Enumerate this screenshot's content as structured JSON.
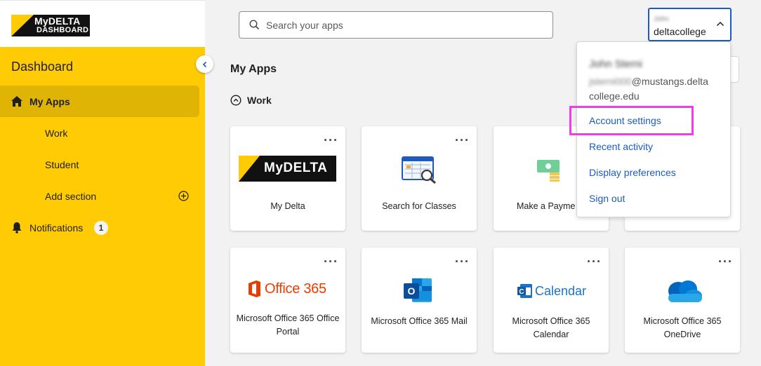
{
  "brand": {
    "logo_line1": "MyDELTA",
    "logo_line2": "DASHBOARD"
  },
  "sidebar": {
    "title": "Dashboard",
    "items": [
      {
        "label": "My Apps",
        "active": true,
        "icon": "home-icon"
      },
      {
        "label": "Work"
      },
      {
        "label": "Student"
      },
      {
        "label": "Add section",
        "icon": "plus-circle-icon"
      },
      {
        "label": "Notifications",
        "icon": "bell-icon",
        "badge": "1"
      }
    ]
  },
  "search": {
    "placeholder": "Search your apps"
  },
  "user": {
    "name": "John",
    "org": "deltacollege"
  },
  "main": {
    "title": "My Apps",
    "section": "Work"
  },
  "apps": [
    {
      "label": "My Delta",
      "icon": "mydelta-logo"
    },
    {
      "label": "Search for Classes",
      "icon": "class-search-icon"
    },
    {
      "label": "Make a Payme",
      "icon": "payment-icon"
    },
    {
      "label": "Microsoft Office 365 Office Portal",
      "icon": "office365-logo",
      "logo_text": "Office 365"
    },
    {
      "label": "Microsoft Office 365 Mail",
      "icon": "outlook-icon"
    },
    {
      "label": "Microsoft Office 365 Calendar",
      "icon": "calendar-icon",
      "logo_text": "Calendar"
    },
    {
      "label": "Microsoft Office 365 OneDrive",
      "icon": "onedrive-icon"
    }
  ],
  "menu": {
    "name": "John Sterni",
    "email_user": "jsterni000",
    "email_domain": "@mustangs.delta college.edu",
    "items": [
      "Account settings",
      "Recent activity",
      "Display preferences",
      "Sign out"
    ]
  },
  "colors": {
    "sidebar": "#ffcb05",
    "link": "#1d5bbf",
    "highlight": "#ee3fe4"
  }
}
